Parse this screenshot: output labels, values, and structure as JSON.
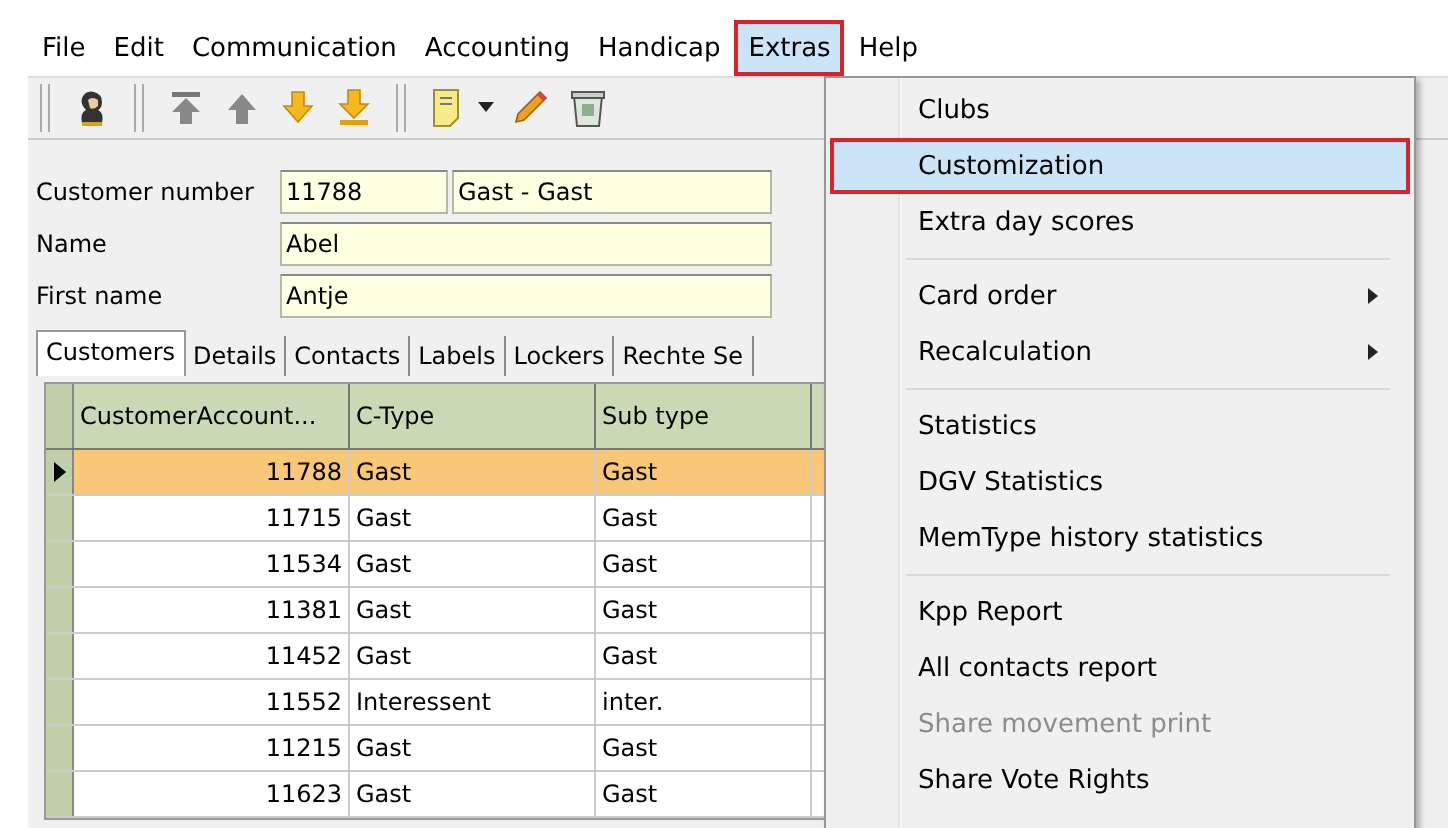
{
  "menu_bar": [
    {
      "label": "File",
      "selected": false
    },
    {
      "label": "Edit",
      "selected": false
    },
    {
      "label": "Communication",
      "selected": false
    },
    {
      "label": "Accounting",
      "selected": false
    },
    {
      "label": "Handicap",
      "selected": false
    },
    {
      "label": "Extras",
      "selected": true
    },
    {
      "label": "Help",
      "selected": false
    }
  ],
  "form": {
    "customer_number_label": "Customer number",
    "customer_number": "11788",
    "customer_type": "Gast - Gast",
    "name_label": "Name",
    "name": "Abel",
    "first_name_label": "First name",
    "first_name": "Antje"
  },
  "tabs": [
    {
      "label": "Customers",
      "selected": true
    },
    {
      "label": "Details",
      "selected": false
    },
    {
      "label": "Contacts",
      "selected": false
    },
    {
      "label": "Labels",
      "selected": false
    },
    {
      "label": "Lockers",
      "selected": false
    },
    {
      "label": "Rechte Se",
      "selected": false
    }
  ],
  "table": {
    "columns": [
      "CustomerAccount...",
      "C-Type",
      "Sub type"
    ],
    "rows": [
      {
        "cells": [
          "11788",
          "Gast",
          "Gast"
        ],
        "selected": true
      },
      {
        "cells": [
          "11715",
          "Gast",
          "Gast"
        ],
        "selected": false
      },
      {
        "cells": [
          "11534",
          "Gast",
          "Gast"
        ],
        "selected": false
      },
      {
        "cells": [
          "11381",
          "Gast",
          "Gast"
        ],
        "selected": false
      },
      {
        "cells": [
          "11452",
          "Gast",
          "Gast"
        ],
        "selected": false
      },
      {
        "cells": [
          "11552",
          "Interessent",
          "inter."
        ],
        "selected": false
      },
      {
        "cells": [
          "11215",
          "Gast",
          "Gast"
        ],
        "selected": false
      },
      {
        "cells": [
          "11623",
          "Gast",
          "Gast"
        ],
        "selected": false
      }
    ]
  },
  "extras_menu": [
    {
      "kind": "item",
      "label": "Clubs",
      "selected": false,
      "disabled": false
    },
    {
      "kind": "item",
      "label": "Customization",
      "selected": true,
      "disabled": false
    },
    {
      "kind": "item",
      "label": "Extra day scores",
      "selected": false,
      "disabled": false
    },
    {
      "kind": "separator"
    },
    {
      "kind": "submenu",
      "label": "Card order",
      "selected": false,
      "disabled": false
    },
    {
      "kind": "submenu",
      "label": "Recalculation",
      "selected": false,
      "disabled": false
    },
    {
      "kind": "separator"
    },
    {
      "kind": "item",
      "label": "Statistics",
      "selected": false,
      "disabled": false
    },
    {
      "kind": "item",
      "label": "DGV Statistics",
      "selected": false,
      "disabled": false
    },
    {
      "kind": "item",
      "label": "MemType history statistics",
      "selected": false,
      "disabled": false
    },
    {
      "kind": "separator"
    },
    {
      "kind": "item",
      "label": "Kpp Report",
      "selected": false,
      "disabled": false
    },
    {
      "kind": "item",
      "label": "All contacts report",
      "selected": false,
      "disabled": false
    },
    {
      "kind": "item",
      "label": "Share movement print",
      "selected": false,
      "disabled": true
    },
    {
      "kind": "item",
      "label": "Share Vote Rights",
      "selected": false,
      "disabled": false
    }
  ]
}
